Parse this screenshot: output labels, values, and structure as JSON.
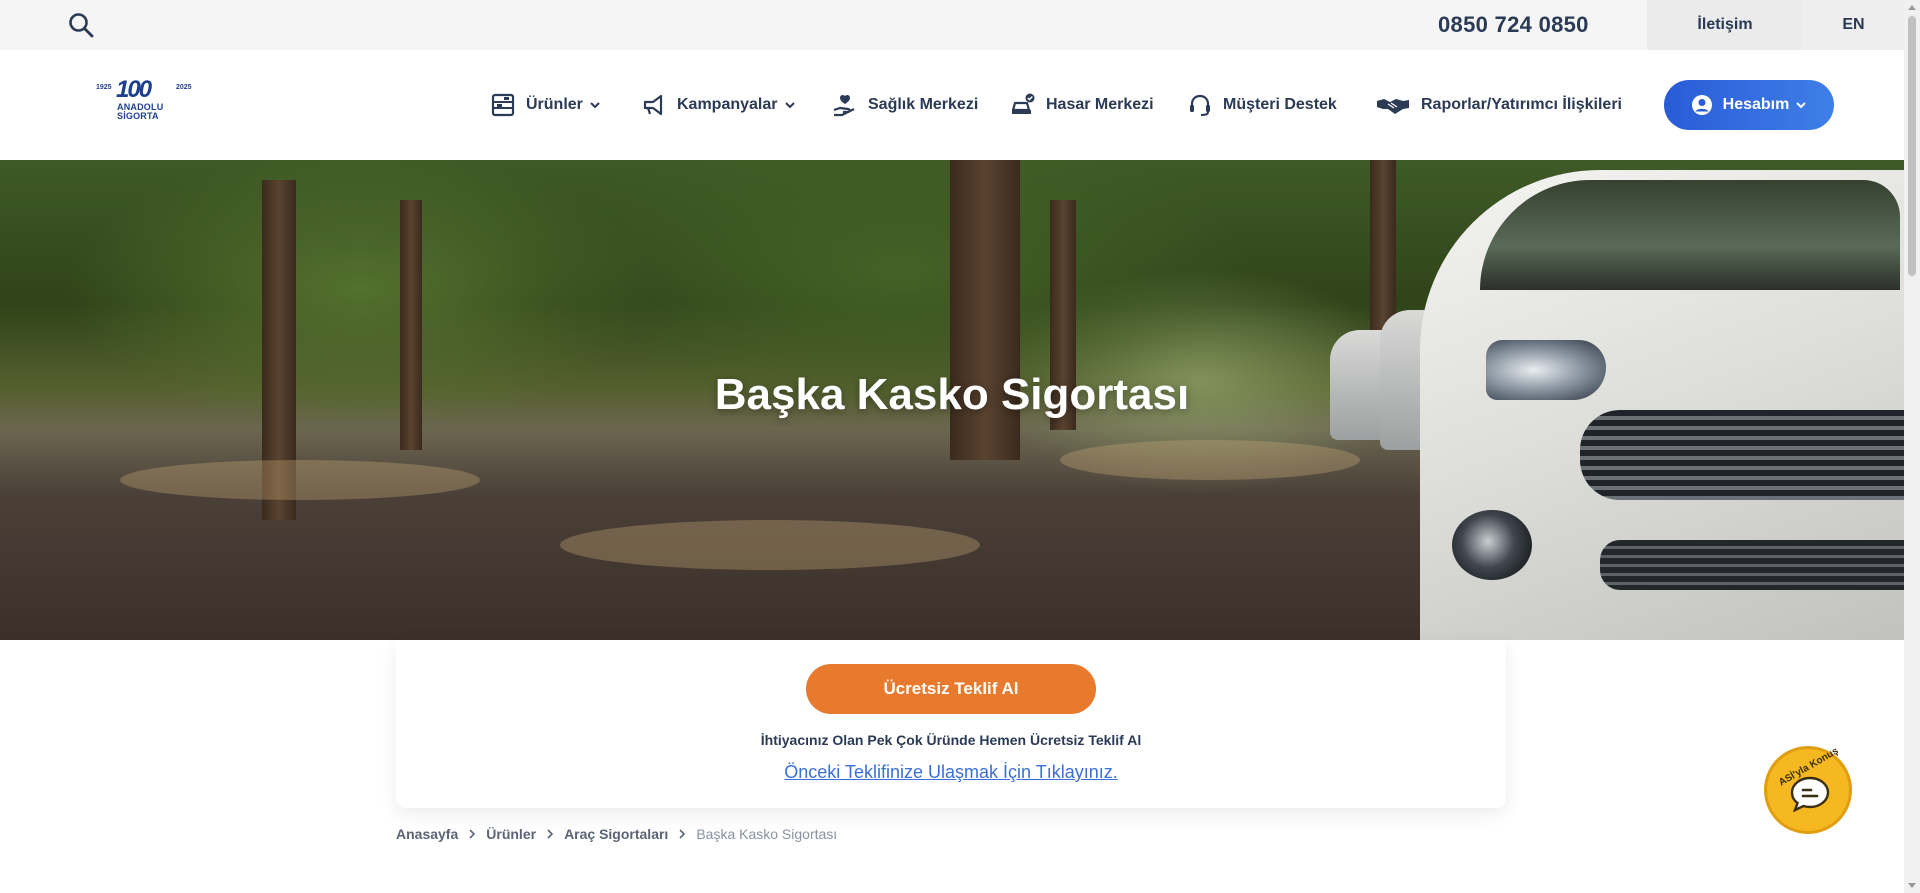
{
  "topbar": {
    "phone": "0850 724 0850",
    "contact_label": "İletişim",
    "lang_label": "EN",
    "search_icon": "search-icon"
  },
  "logo": {
    "year_start": "1925",
    "year_end": "2025",
    "hundred": "100",
    "name_line1": "ANADOLU",
    "name_line2": "SİGORTA"
  },
  "nav": {
    "items": [
      {
        "label": "Ürünler",
        "icon": "products-icon",
        "dropdown": true
      },
      {
        "label": "Kampanyalar",
        "icon": "megaphone-icon",
        "dropdown": true
      },
      {
        "label": "Sağlık Merkezi",
        "icon": "health-hand-icon",
        "dropdown": false
      },
      {
        "label": "Hasar Merkezi",
        "icon": "car-damage-icon",
        "dropdown": false
      },
      {
        "label": "Müşteri Destek",
        "icon": "headset-icon",
        "dropdown": false
      },
      {
        "label": "Raporlar/Yatırımcı İlişkileri",
        "icon": "handshake-icon",
        "dropdown": false
      }
    ],
    "account_label": "Hesabım"
  },
  "hero": {
    "title": "Başka Kasko Sigortası"
  },
  "quote": {
    "button_label": "Ücretsiz Teklif Al",
    "subtitle": "İhtiyacınız Olan Pek Çok Üründe Hemen Ücretsiz Teklif Al",
    "link_label": "Önceki Teklifinize Ulaşmak İçin Tıklayınız."
  },
  "breadcrumb": {
    "items": [
      "Anasayfa",
      "Ürünler",
      "Araç Sigortaları",
      "Başka Kasko Sigortası"
    ]
  },
  "chat": {
    "label": "ASİ'yla Konuş"
  },
  "colors": {
    "primary_text": "#2b3a55",
    "account_blue": "#2a5bd7",
    "quote_orange": "#e87a2e",
    "link_blue": "#3b6fd8",
    "chat_yellow": "#f5b820"
  }
}
